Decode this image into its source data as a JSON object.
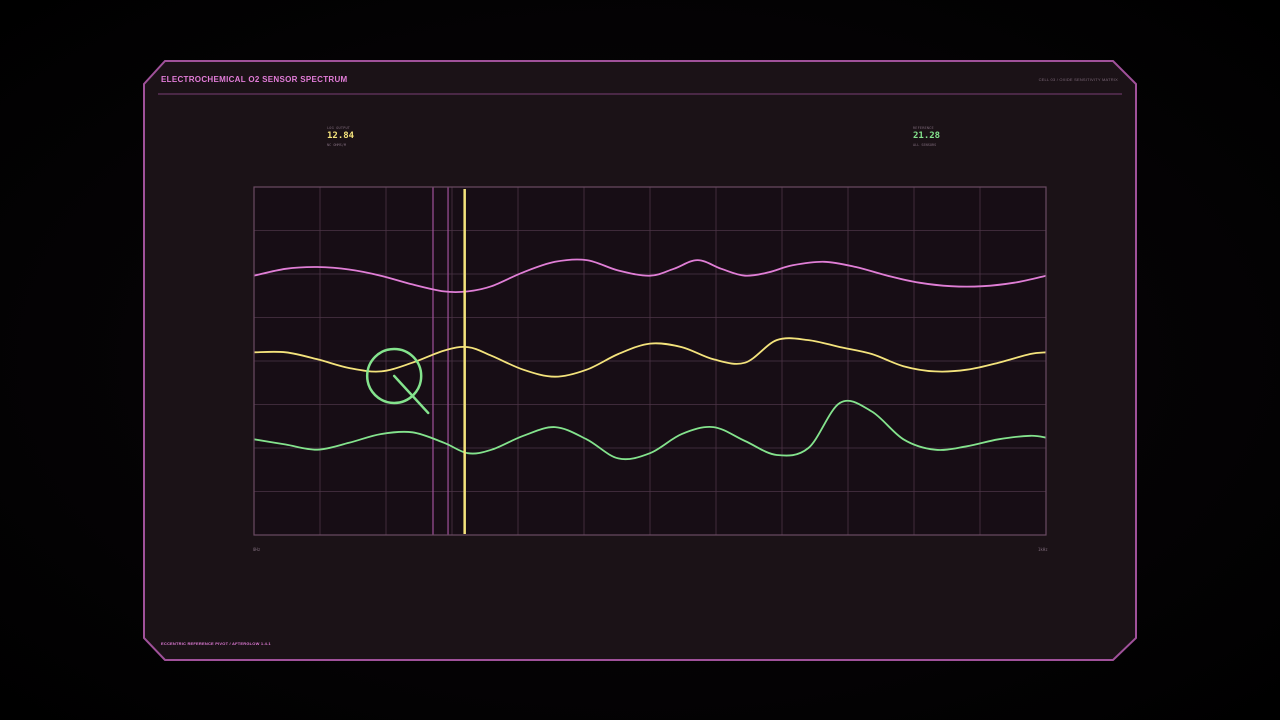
{
  "panel": {
    "title": "ELECTROCHEMICAL O2 SENSOR SPECTRUM",
    "meta": "CELL 03 / OXIDE SENSITIVITY MATRIX",
    "footer": "ECCENTRIC REFERENCE PIVOT / AFTERGLOW 1.4.1"
  },
  "readouts": {
    "left": {
      "label": "LOG OUTPUT",
      "value": "12.84",
      "sub": "NC OHMS/M"
    },
    "right": {
      "label": "REFERENCE",
      "value": "21.28",
      "sub": "ALL SENSORS"
    }
  },
  "axis": {
    "min_label": "0Hz",
    "max_label": "1kHz"
  },
  "colors": {
    "background": "#1b1217",
    "frame": "#a0519a",
    "title": "#e27cd8",
    "meta": "#7e6a7a",
    "grid": "#4d3447",
    "series_pink": "#e07ed6",
    "series_yellow": "#f4e37c",
    "series_green": "#84e38d",
    "cursor": "#f4e37c",
    "marker": "#84e38d"
  },
  "icons": {
    "search_marker": "magnifier-icon"
  },
  "chart_data": {
    "type": "line",
    "grid": true,
    "grid_columns": 12,
    "grid_rows": 8,
    "xlim": [
      0,
      100
    ],
    "ylim": [
      0,
      100
    ],
    "cursor_x": 26.6,
    "ref_lines_x": [
      22.6,
      24.5
    ],
    "marker": {
      "x": 17.7,
      "y": 45.7
    },
    "series": [
      {
        "color": "#e07ed6",
        "x": [
          0,
          4,
          8,
          12,
          16,
          20,
          24,
          27,
          30,
          34,
          38,
          42,
          46,
          50,
          53,
          56,
          59,
          62,
          65,
          68,
          72,
          76,
          80,
          84,
          88,
          92,
          96,
          100
        ],
        "y": [
          74.5,
          76.5,
          77.0,
          76.3,
          74.5,
          72.0,
          70.0,
          70.0,
          71.5,
          75.5,
          78.5,
          79.0,
          76.0,
          74.5,
          76.5,
          79.0,
          76.5,
          74.5,
          75.5,
          77.5,
          78.5,
          77.0,
          74.5,
          72.5,
          71.5,
          71.5,
          72.5,
          74.5
        ]
      },
      {
        "color": "#f4e37c",
        "x": [
          0,
          4,
          8,
          12,
          16,
          20,
          24,
          27,
          30,
          34,
          38,
          42,
          46,
          50,
          54,
          58,
          62,
          66,
          70,
          74,
          78,
          82,
          86,
          90,
          94,
          98,
          100
        ],
        "y": [
          52.5,
          52.5,
          50.5,
          48.0,
          47.0,
          49.5,
          53.0,
          54.0,
          51.5,
          47.5,
          45.5,
          47.5,
          52.0,
          55.0,
          54.0,
          50.5,
          49.5,
          56.0,
          56.0,
          54.0,
          52.0,
          48.5,
          47.0,
          47.5,
          49.5,
          52.0,
          52.5
        ]
      },
      {
        "color": "#84e38d",
        "x": [
          0,
          4,
          8,
          12,
          16,
          20,
          24,
          27,
          30,
          34,
          38,
          42,
          46,
          50,
          54,
          58,
          62,
          66,
          70,
          74,
          78,
          82,
          86,
          90,
          94,
          98,
          100
        ],
        "y": [
          27.5,
          26.0,
          24.5,
          26.5,
          29.0,
          29.5,
          26.5,
          23.5,
          24.5,
          28.5,
          31.0,
          27.5,
          22.0,
          23.5,
          29.0,
          31.0,
          27.0,
          23.0,
          25.0,
          38.0,
          35.5,
          27.5,
          24.5,
          25.5,
          27.5,
          28.5,
          28.0
        ]
      }
    ]
  }
}
